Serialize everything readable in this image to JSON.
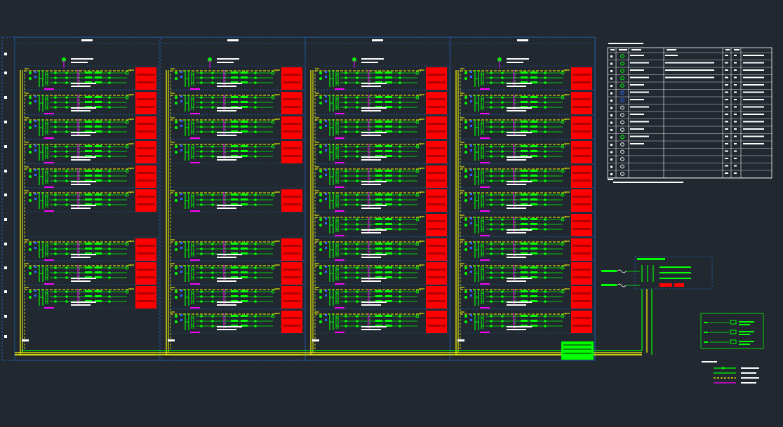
{
  "drawing": {
    "columns": [
      {
        "header": "",
        "rows": [
          1,
          1,
          1,
          1,
          1,
          1,
          0,
          1,
          1,
          1,
          0
        ]
      },
      {
        "header": "",
        "rows": [
          1,
          1,
          1,
          1,
          0,
          1,
          0,
          1,
          1,
          1,
          1
        ]
      },
      {
        "header": "",
        "rows": [
          1,
          1,
          1,
          1,
          1,
          1,
          1,
          1,
          1,
          1,
          1
        ]
      },
      {
        "header": "",
        "rows": [
          1,
          1,
          1,
          1,
          1,
          1,
          1,
          1,
          1,
          1,
          1
        ]
      }
    ],
    "row_labels": [
      "",
      "",
      "",
      "",
      "",
      "",
      "",
      "",
      "",
      "",
      ""
    ]
  },
  "legend_table": {
    "title": "",
    "header": [
      "",
      "",
      "",
      "",
      "",
      ""
    ],
    "row_count": 17,
    "note": ""
  },
  "mini_panel": {
    "labels": [
      "",
      "",
      ""
    ]
  },
  "key_box": {
    "labels": [
      "",
      "",
      ""
    ]
  },
  "line_legend": {
    "title": "",
    "labels": [
      "",
      "",
      "",
      ""
    ]
  },
  "colors": {
    "background": "#212830",
    "wire": "#00ff00",
    "bus": "#ffff00",
    "accent": "#ff00ff",
    "device": "#ff0000",
    "frame": "#1e6fd0",
    "text": "#ffffff",
    "table_line": "#ffffff"
  }
}
